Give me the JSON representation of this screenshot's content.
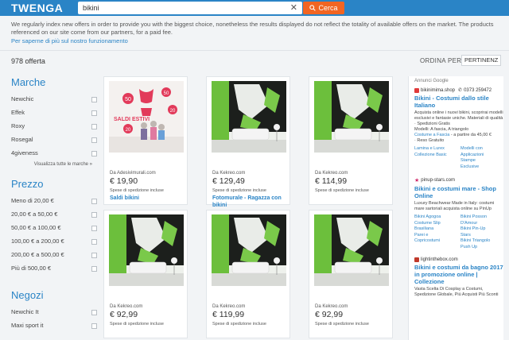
{
  "header": {
    "logo": "TWENGA",
    "search_value": "bikini",
    "search_button": "Cerca",
    "clear_icon": "close-icon",
    "search_icon": "search-icon"
  },
  "notice": {
    "text": "We regularly index new offers in order to provide you with the biggest choice, nonetheless the results displayed do not reflect the totality of available offers on the market. The products referenced on our site come from our partners, for a paid fee.",
    "link": "Per saperne di più sul nostro funzionamento"
  },
  "results": {
    "count": "978 offerta",
    "sort_label": "ORDINA PER :",
    "sort_value": "PERTINENZ"
  },
  "sidebar": {
    "marche_title": "Marche",
    "marche": [
      "Newchic",
      "Effek",
      "Roxy",
      "Rosegal",
      "4giveness"
    ],
    "see_all": "Visualizza tutte le marche »",
    "prezzo_title": "Prezzo",
    "prezzo": [
      "Meno di 20,00 €",
      "20,00 € a 50,00 €",
      "50,00 € a 100,00 €",
      "100,00 € a 200,00 €",
      "200,00 € a 500,00 €",
      "Più di 500,00 €"
    ],
    "negozi_title": "Negozi",
    "negozi": [
      "Newchic It",
      "Maxi sport it"
    ]
  },
  "products": [
    {
      "merchant": "Da Adesivimurali.com",
      "price": "€ 19,90",
      "shipping": "Spese di spedizione incluse",
      "name": "Saldi bikini",
      "image": "sale-window"
    },
    {
      "merchant": "Da Kekreo.com",
      "price": "€ 129,49",
      "shipping": "Spese di spedizione incluse",
      "name": "Fotomurale - Ragazza con bikini",
      "image": "mural"
    },
    {
      "merchant": "Da Kekreo.com",
      "price": "€ 114,99",
      "shipping": "Spese di spedizione incluse",
      "name": "",
      "image": "mural"
    },
    {
      "merchant": "Da Kekreo.com",
      "price": "€ 92,99",
      "shipping": "Spese di spedizione incluse",
      "name": "",
      "image": "mural"
    },
    {
      "merchant": "Da Kekreo.com",
      "price": "€ 119,99",
      "shipping": "Spese di spedizione incluse",
      "name": "",
      "image": "mural"
    },
    {
      "merchant": "Da Kekreo.com",
      "price": "€ 92,99",
      "shipping": "Spese di spedizione incluse",
      "name": "",
      "image": "mural"
    }
  ],
  "sale_image": {
    "sign": "SALDI ESTIVI",
    "badges": [
      "50",
      "50",
      "20",
      "20"
    ]
  },
  "ads": {
    "title": "Annunci Google",
    "items": [
      {
        "url": "bikinimima.shop",
        "phone": "0373 259472",
        "title": "Bikini - Costumi dallo stile Italiano",
        "desc": "Acquista online i nuovi bikini, scoprirai modelli esclusivi e fantasie uniche. Materiali di qualità · Spedizioni Gratis",
        "sub1": "Modelli: A fascia, A triangolo",
        "sub2_link": "Costume a Fascia",
        "sub2_rest": "- a partire da 45,00 €",
        "sub3": "· Reso Gratuito",
        "links": [
          "Lamina e Lurex",
          "Modelli con",
          "Collezione Basic",
          "Applicazioni",
          "",
          "Stampe",
          "",
          "Esclusive"
        ],
        "fav_color": "#e03a3a"
      },
      {
        "url": "pinup-stars.com",
        "phone": "",
        "title": "Bikini e costumi mare - Shop Online",
        "desc": "Luxury Beachwear Made in Italy: costumi mare sartoriali acquista online su PinUp",
        "links": [
          "Bikini Agogoa",
          "Bikini Posson",
          "Costume Slip",
          "D'Amour",
          "Brasiliana",
          "Bikini Pin-Up",
          "Parei e",
          "Stars",
          "Copricostumi",
          "Bikini Triangolo",
          "",
          "Push Up"
        ],
        "fav_color": "#d02a6a"
      },
      {
        "url": "lightinthebox.com",
        "phone": "",
        "title": "Bikini e costumi da bagno 2017 in promozione online | Collezione",
        "desc": "Vasta Scelta Di Cosplay a Costumi, Spedizione Globale, Più Acquisti Più Sconti",
        "links": [],
        "fav_color": "#c0392b"
      }
    ]
  }
}
